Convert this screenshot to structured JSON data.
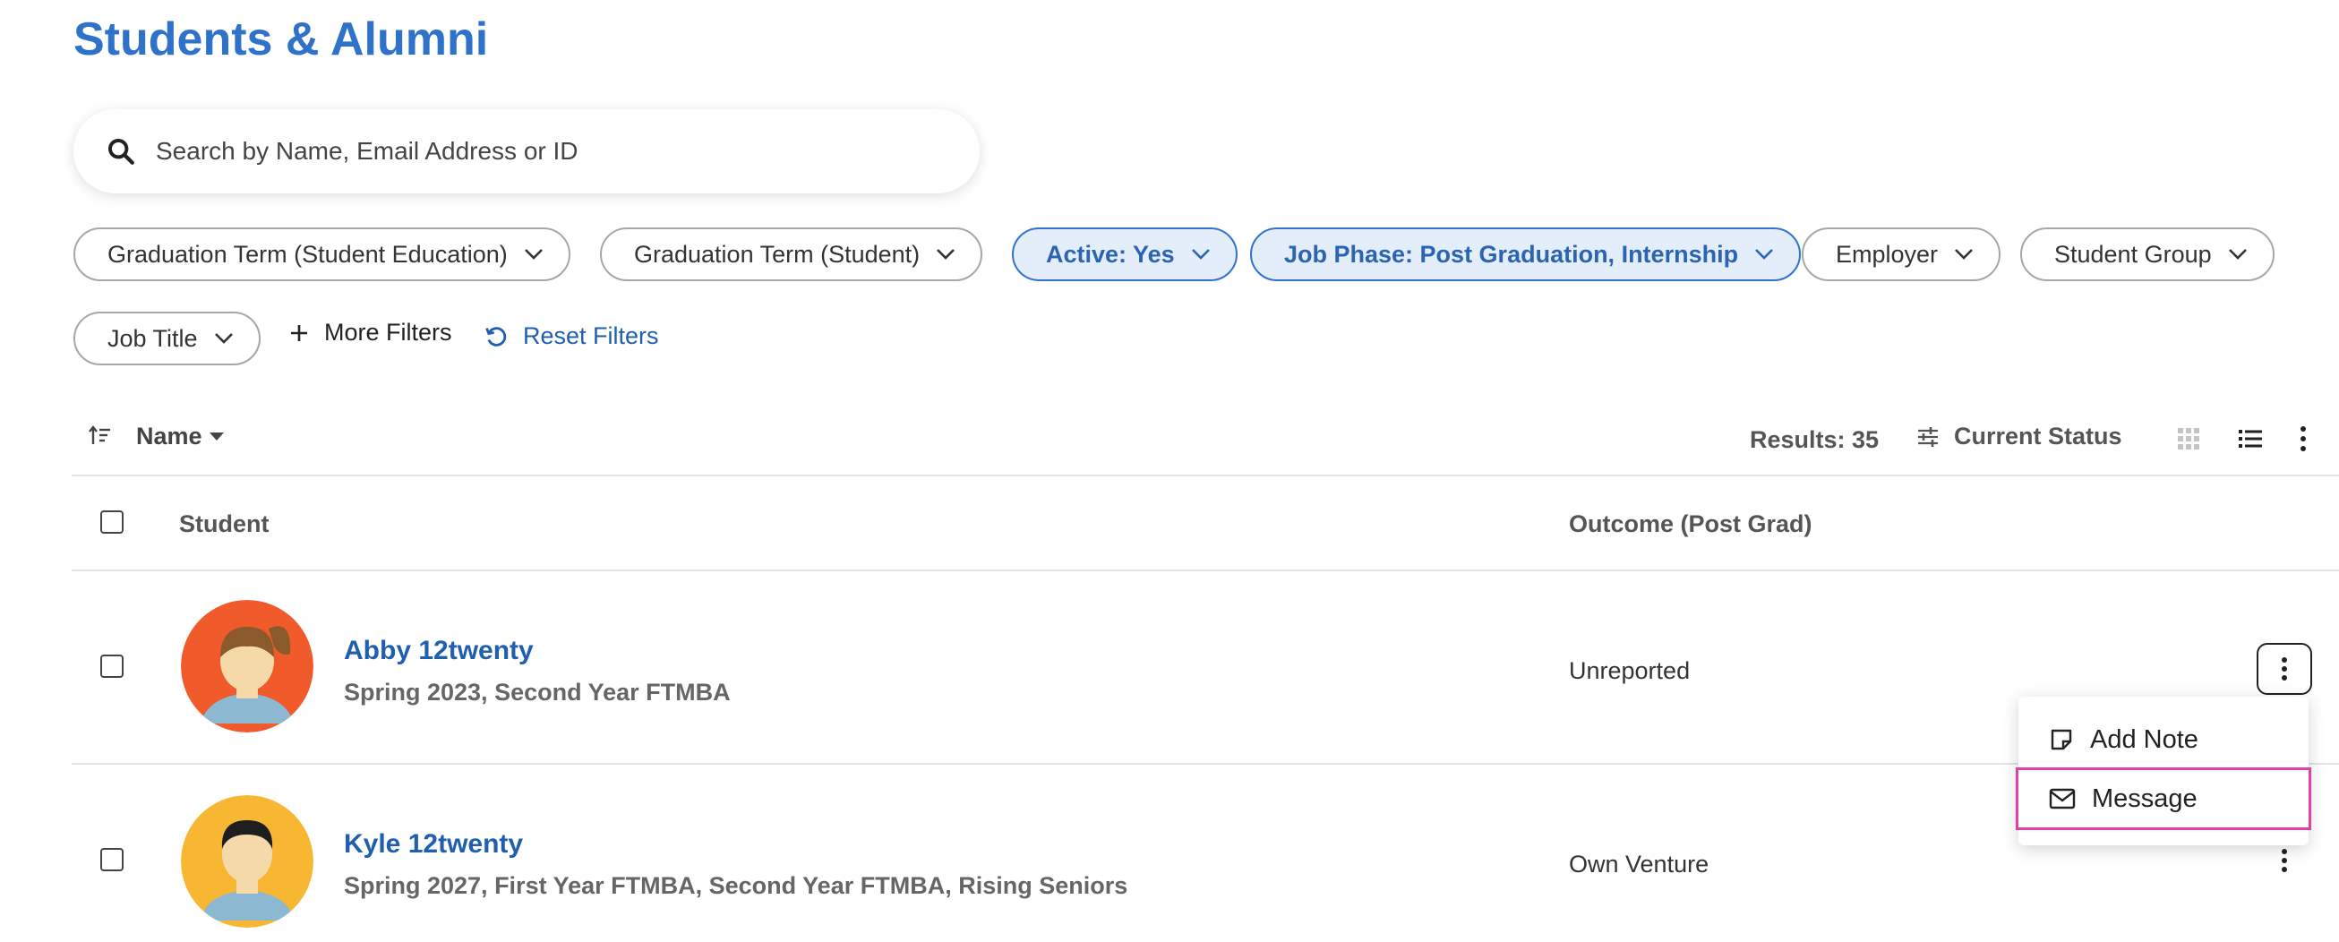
{
  "page": {
    "title": "Students & Alumni"
  },
  "search": {
    "placeholder": "Search by Name, Email Address or ID",
    "value": ""
  },
  "filters": [
    {
      "label": "Graduation Term (Student Education)",
      "active": false
    },
    {
      "label": "Graduation Term (Student)",
      "active": false
    },
    {
      "label": "Active: Yes",
      "active": true
    },
    {
      "label": "Job Phase: Post Graduation, Internship",
      "active": true
    },
    {
      "label": "Employer",
      "active": false
    },
    {
      "label": "Student Group",
      "active": false
    },
    {
      "label": "Job Title",
      "active": false
    }
  ],
  "filter_actions": {
    "more_label": "More Filters",
    "reset_label": "Reset Filters"
  },
  "toolbar": {
    "sort_label": "Name",
    "results_label": "Results: 35",
    "status_label": "Current Status"
  },
  "table": {
    "columns": [
      "Student",
      "Outcome (Post Grad)"
    ],
    "rows": [
      {
        "name": "Abby 12twenty",
        "details": "Spring 2023, Second Year FTMBA",
        "outcome": "Unreported"
      },
      {
        "name": "Kyle 12twenty",
        "details": "Spring 2027, First Year FTMBA, Second Year FTMBA, Rising Seniors",
        "outcome": "Own Venture"
      }
    ]
  },
  "row_menu": {
    "items": [
      "Add Note",
      "Message"
    ]
  },
  "colors": {
    "accent": "#2e73c9",
    "link": "#1f5fae",
    "active_chip_bg": "#e4eefb",
    "highlight": "#e53ea8"
  }
}
